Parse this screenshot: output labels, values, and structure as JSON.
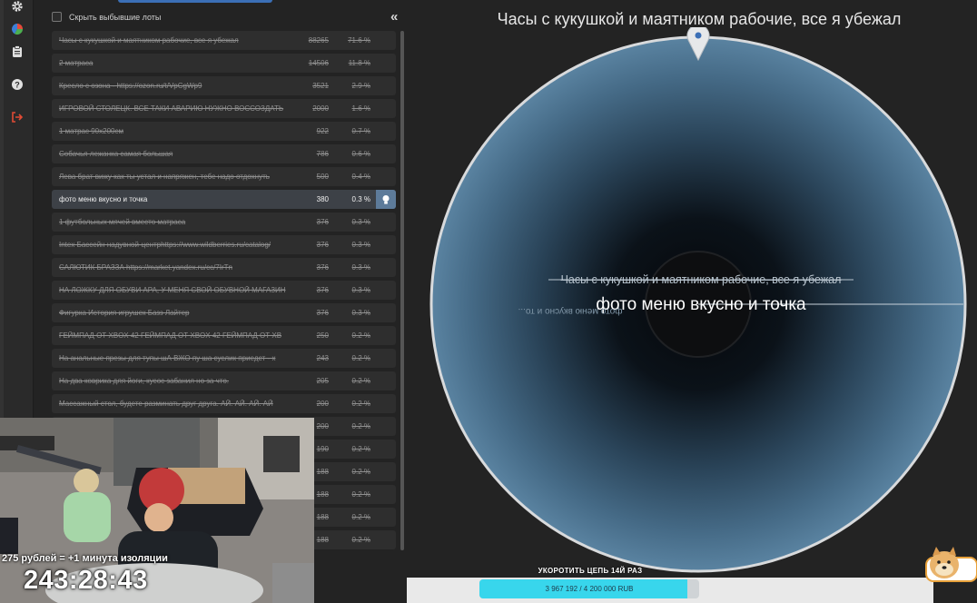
{
  "panel": {
    "hide_checkbox_label": "Скрыть выбывшие лоты",
    "collapse_icon": "double-chevron-left-icon"
  },
  "lots": [
    {
      "name": "Часы с кукушкой и маятником рабочие, все я убежал",
      "amount": "88265",
      "pct": "71.6 %",
      "eliminated": true
    },
    {
      "name": "2 матраса",
      "amount": "14506",
      "pct": "11.8 %",
      "eliminated": true
    },
    {
      "name": "Кресло с озона - https://ozon.ru/t/VpCgWp9",
      "amount": "3521",
      "pct": "2.9 %",
      "eliminated": true
    },
    {
      "name": "ИГРОВОЙ СТОЛЕЦК. ВСЕ ТАКИ АВАРИЮ НУЖНО ВОССОЗДАТЬ",
      "amount": "2000",
      "pct": "1.6 %",
      "eliminated": true
    },
    {
      "name": "1 матрас 90х200см",
      "amount": "922",
      "pct": "0.7 %",
      "eliminated": true
    },
    {
      "name": "Собачья лежанка самая большая",
      "amount": "786",
      "pct": "0.6 %",
      "eliminated": true
    },
    {
      "name": "Лева брат вижу как ты устал и напряжен, тебе надо отдохнуть",
      "amount": "500",
      "pct": "0.4 %",
      "eliminated": true
    },
    {
      "name": "фото меню вкусно и точка",
      "amount": "380",
      "pct": "0.3 %",
      "eliminated": false
    },
    {
      "name": "1 футбольных мячей вместо матраса",
      "amount": "376",
      "pct": "0.3 %",
      "eliminated": true
    },
    {
      "name": "Intex Бассейн надувной-центрhttps://www.wildberries.ru/catalog/",
      "amount": "376",
      "pct": "0.3 %",
      "eliminated": true
    },
    {
      "name": "САЛЮТИК БРАЗЗА https://market.yandex.ru/cc/7IrTn",
      "amount": "376",
      "pct": "0.3 %",
      "eliminated": true
    },
    {
      "name": "НА ЛОЖКУ ДЛЯ ОБУВИ АРА, У МЕНЯ СВОЙ ОБУВНОЙ МАГАЗИН",
      "amount": "376",
      "pct": "0.3 %",
      "eliminated": true
    },
    {
      "name": "Фигурка История игрушек Базз Лайтер",
      "amount": "376",
      "pct": "0.3 %",
      "eliminated": true
    },
    {
      "name": "ГЕЙМПАД ОТ XBOX 42 ГЕЙМПАД ОТ XBOX 42 ГЕЙМПАД ОТ XB",
      "amount": "250",
      "pct": "0.2 %",
      "eliminated": true
    },
    {
      "name": "На анальные презы для тупы шА ВЖО пу ша суслик приедет - х",
      "amount": "243",
      "pct": "0.2 %",
      "eliminated": true
    },
    {
      "name": "На два коврика для йоги, кусос забанил но за что.",
      "amount": "205",
      "pct": "0.2 %",
      "eliminated": true
    },
    {
      "name": "Массажный стол, будете разминать друг друга. АЙ. АЙ. АЙ. АЙ",
      "amount": "200",
      "pct": "0.2 %",
      "eliminated": true
    },
    {
      "name": "",
      "amount": "200",
      "pct": "0.2 %",
      "eliminated": true
    },
    {
      "name": "",
      "amount": "190",
      "pct": "0.2 %",
      "eliminated": true
    },
    {
      "name": "",
      "amount": "188",
      "pct": "0.2 %",
      "eliminated": true
    },
    {
      "name": "",
      "amount": "188",
      "pct": "0.2 %",
      "eliminated": true
    },
    {
      "name": "",
      "amount": "188",
      "pct": "0.2 %",
      "eliminated": true
    },
    {
      "name": "",
      "amount": "188",
      "pct": "0.2 %",
      "eliminated": true
    }
  ],
  "wheel": {
    "title": "Часы с кукушкой и маятником рабочие, все я убежал",
    "eliminated_label": "Часы с кукушкой и маятником рабочие, все я убежал",
    "selected_label": "фото меню вкусно и точка",
    "mirrored_label": "фото меню вкусно и то...",
    "pointer_icon": "map-pin-icon"
  },
  "stream": {
    "caption": "275 рублей = +1 минута изоляции",
    "timer": "243:28:43"
  },
  "goal": {
    "title": "УКОРОТИТЬ ЦЕПЬ 14Й РАЗ",
    "progress_text": "3 967 192 / 4 200 000 RUB",
    "progress_fraction": 0.9446
  },
  "rail": {
    "icons": [
      "gear-icon",
      "pie-chart-icon",
      "clipboard-icon",
      "help-icon",
      "logout-icon"
    ]
  },
  "colors": {
    "selected_row": "#3d4147",
    "wheel_fill": "#4a6f8d",
    "goal_fill": "#38d6ec",
    "logout": "#e04b35"
  }
}
